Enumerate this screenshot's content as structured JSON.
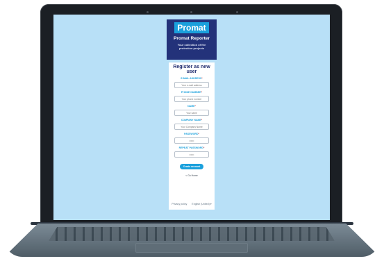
{
  "header": {
    "logo_text": "Promat",
    "app_title": "Promat Reporter",
    "tagline_line1": "Your collection of fire",
    "tagline_line2": "protection projects"
  },
  "form": {
    "title": "Register as new user",
    "required_mark": "*",
    "fields": [
      {
        "label": "E-MAIL ADDRESS",
        "placeholder": "Your e-mail address"
      },
      {
        "label": "PHONE NUMBER",
        "placeholder": "Your phone number"
      },
      {
        "label": "NAME",
        "placeholder": "Your name"
      },
      {
        "label": "COMPANY NAME",
        "placeholder": "Your Company Name"
      },
      {
        "label": "PASSWORD",
        "placeholder": "••••••"
      },
      {
        "label": "REPEAT PASSWORD",
        "placeholder": "••••••"
      }
    ],
    "submit_label": "Create account",
    "back_label": "< Go Home"
  },
  "footer": {
    "privacy": "Privacy policy",
    "language": "English (United) ▾"
  }
}
